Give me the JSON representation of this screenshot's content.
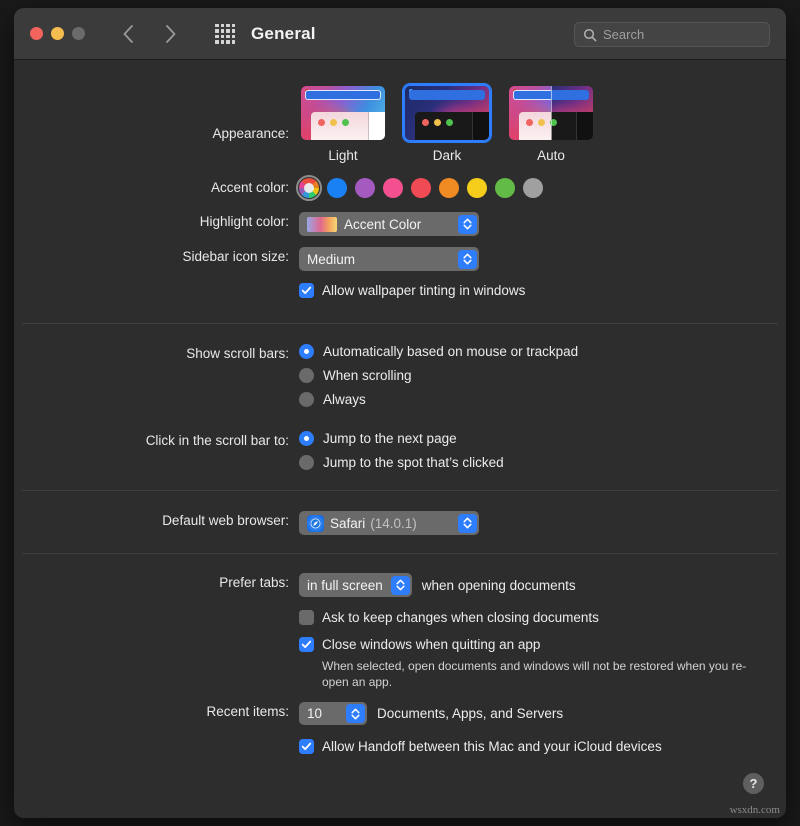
{
  "window": {
    "title": "General",
    "traffic_lights": [
      "close",
      "minimize",
      "zoom"
    ],
    "nav": {
      "back": "Back",
      "forward": "Forward",
      "grid": "Show All"
    },
    "search": {
      "placeholder": "Search",
      "value": ""
    }
  },
  "appearance": {
    "label": "Appearance:",
    "options": [
      {
        "id": "light",
        "label": "Light",
        "selected": false
      },
      {
        "id": "dark",
        "label": "Dark",
        "selected": true
      },
      {
        "id": "auto",
        "label": "Auto",
        "selected": false
      }
    ]
  },
  "accent_color": {
    "label": "Accent color:",
    "selected_index": 0,
    "swatches": [
      {
        "name": "multicolor",
        "hex": "multicolor"
      },
      {
        "name": "blue",
        "hex": "#1a81f5"
      },
      {
        "name": "purple",
        "hex": "#a55ac0"
      },
      {
        "name": "pink",
        "hex": "#f2508f"
      },
      {
        "name": "red",
        "hex": "#f04a54"
      },
      {
        "name": "orange",
        "hex": "#f08a22"
      },
      {
        "name": "yellow",
        "hex": "#f5cd1b"
      },
      {
        "name": "green",
        "hex": "#62bb46"
      },
      {
        "name": "graphite",
        "hex": "#a0a0a0"
      }
    ]
  },
  "highlight_color": {
    "label": "Highlight color:",
    "value": "Accent Color"
  },
  "sidebar_icon_size": {
    "label": "Sidebar icon size:",
    "value": "Medium"
  },
  "wallpaper_tinting": {
    "label": "Allow wallpaper tinting in windows",
    "checked": true
  },
  "scroll_bars": {
    "label": "Show scroll bars:",
    "options": [
      {
        "label": "Automatically based on mouse or trackpad",
        "selected": true
      },
      {
        "label": "When scrolling",
        "selected": false
      },
      {
        "label": "Always",
        "selected": false
      }
    ]
  },
  "scroll_bar_click": {
    "label": "Click in the scroll bar to:",
    "options": [
      {
        "label": "Jump to the next page",
        "selected": true
      },
      {
        "label": "Jump to the spot that’s clicked",
        "selected": false
      }
    ]
  },
  "default_browser": {
    "label": "Default web browser:",
    "app_name": "Safari",
    "version": "(14.0.1)"
  },
  "prefer_tabs": {
    "label": "Prefer tabs:",
    "value": "in full screen",
    "trailing": "when opening documents"
  },
  "ask_keep_changes": {
    "label": "Ask to keep changes when closing documents",
    "checked": false
  },
  "close_windows": {
    "label": "Close windows when quitting an app",
    "checked": true,
    "helper": "When selected, open documents and windows will not be restored when you re-open an app."
  },
  "recent_items": {
    "label": "Recent items:",
    "value": "10",
    "trailing": "Documents, Apps, and Servers"
  },
  "handoff": {
    "label": "Allow Handoff between this Mac and your iCloud devices",
    "checked": true
  },
  "help_button": {
    "glyph": "?"
  },
  "watermark": "wsxdn.com",
  "colors": {
    "accent_blue": "#2d7dfd",
    "window_bg": "#2d2d2d",
    "titlebar_bg": "#3b3b3b",
    "control_gray": "#6a6a6a"
  }
}
